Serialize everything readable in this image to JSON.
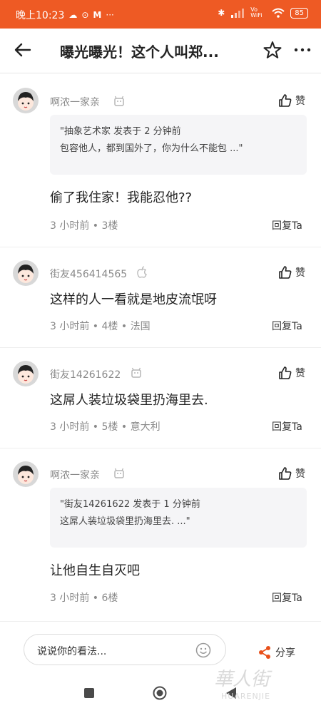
{
  "statusbar": {
    "time": "晚上10:23",
    "volte": "Vo WiFi",
    "battery": "85"
  },
  "header": {
    "title": "曝光曝光！这个人叫郑..."
  },
  "comments": [
    {
      "username": "啊浓一家亲",
      "device": "android",
      "like": "赞",
      "quote_line1": "\"抽象艺术家 发表于 2 分钟前",
      "quote_line2": "包容他人，都到国外了，你为什么不能包 ...\"",
      "text": "偷了我住家！我能忍他??",
      "meta": "3 小时前 • 3楼",
      "reply": "回复Ta"
    },
    {
      "username": "街友456414565",
      "device": "apple",
      "like": "赞",
      "text": "这样的人一看就是地皮流氓呀",
      "meta": "3 小时前 • 4楼 • 法国",
      "reply": "回复Ta"
    },
    {
      "username": "街友14261622",
      "device": "android",
      "like": "赞",
      "text": "这屌人装垃圾袋里扔海里去.",
      "meta": "3 小时前 • 5楼 • 意大利",
      "reply": "回复Ta"
    },
    {
      "username": "啊浓一家亲",
      "device": "android",
      "like": "赞",
      "quote_line1": "\"街友14261622 发表于 1 分钟前",
      "quote_line2": "这屌人装垃圾袋里扔海里去. ...\"",
      "text": "让他自生自灭吧",
      "meta": "3 小时前 • 6楼",
      "reply": "回复Ta"
    }
  ],
  "input": {
    "placeholder": "说说你的看法..."
  },
  "share_label": "分享",
  "watermark": {
    "main": "華人街",
    "sub": "HUARENJIE"
  },
  "colors": {
    "statusbar": "#ee5a24",
    "share_icon": "#e8501a"
  }
}
